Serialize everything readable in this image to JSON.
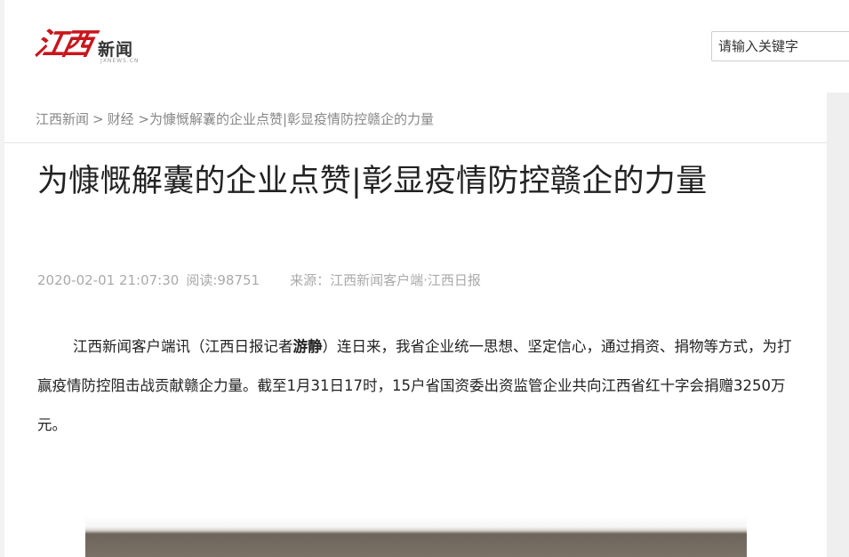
{
  "header": {
    "logo_mark": "江西",
    "logo_text": "新闻",
    "logo_sub": "JXNEWS.CN",
    "search_placeholder": "请输入关键字"
  },
  "breadcrumb": {
    "items": [
      "江西新闻",
      "财经"
    ],
    "separator": ">",
    "current": ">为慷慨解囊的企业点赞|彰显疫情防控赣企的力量"
  },
  "article": {
    "title": "为慷慨解囊的企业点赞|彰显疫情防控赣企的力量",
    "date": "2020-02-01 21:07:30",
    "reads": "阅读:98751",
    "source": "来源：江西新闻客户端·江西日报",
    "para_prefix": "江西新闻客户端讯（江西日报记者",
    "reporter": "游静",
    "para_suffix": "）连日来，我省企业统一思想、坚定信心，通过捐资、捐物等方式，为打赢疫情防控阻击战贡献赣企力量。截至1月31日17时，15户省国资委出资监管企业共向江西省红十字会捐赠3250万元。"
  },
  "colors": {
    "brand_red": "#c8161d",
    "meta_gray": "#aaaaaa",
    "text": "#222222"
  }
}
